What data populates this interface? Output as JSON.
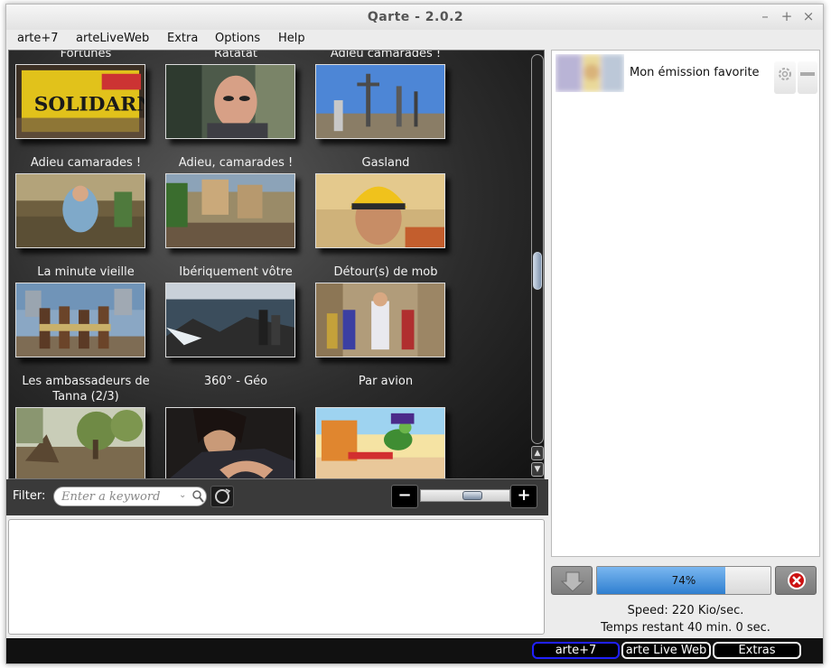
{
  "window": {
    "title": "Qarte - 2.0.2"
  },
  "menubar": [
    {
      "label": "arte+7"
    },
    {
      "label": "arteLiveWeb"
    },
    {
      "label": "Extra"
    },
    {
      "label": "Options"
    },
    {
      "label": "Help"
    }
  ],
  "gallery": {
    "tiles": [
      {
        "title": "Fortunes",
        "scene": "solidarnosc"
      },
      {
        "title": "Ratatat",
        "scene": "portrait-man"
      },
      {
        "title": "Adieu camarades !",
        "scene": "crosses-sky"
      },
      {
        "title": "Adieu camarades !",
        "scene": "living-room"
      },
      {
        "title": "Adieu, camarades !",
        "scene": "crowd-town"
      },
      {
        "title": "Gasland",
        "scene": "helmet-man"
      },
      {
        "title": "La minute vieille",
        "scene": "tribe"
      },
      {
        "title": "Ibériquement vôtre",
        "scene": "sea-rocks"
      },
      {
        "title": "Détour(s) de mob",
        "scene": "parade"
      },
      {
        "title": "Les ambassadeurs de Tanna (2/3)",
        "scene": "field-trees"
      },
      {
        "title": "360° - Géo",
        "scene": "embrace"
      },
      {
        "title": "Par avion",
        "scene": "cartoon"
      }
    ]
  },
  "filter": {
    "label": "Filter:",
    "placeholder": "Enter a keyword"
  },
  "zoom": {
    "minus": "−",
    "plus": "+"
  },
  "favorites": [
    {
      "label": "Mon émission favorite"
    }
  ],
  "download": {
    "percent_text": "74%",
    "progress": 0.74,
    "speed": "Speed: 220 Kio/sec.",
    "remaining": "Temps restant 40 min. 0 sec."
  },
  "tabs": [
    {
      "label": "arte+7",
      "active": true
    },
    {
      "label": "arte Live Web",
      "active": false
    },
    {
      "label": "Extras",
      "active": false
    }
  ],
  "colors": {
    "accent": "#2f7fd0",
    "active_tab_border": "#2020ff",
    "cancel": "#cc1111"
  }
}
